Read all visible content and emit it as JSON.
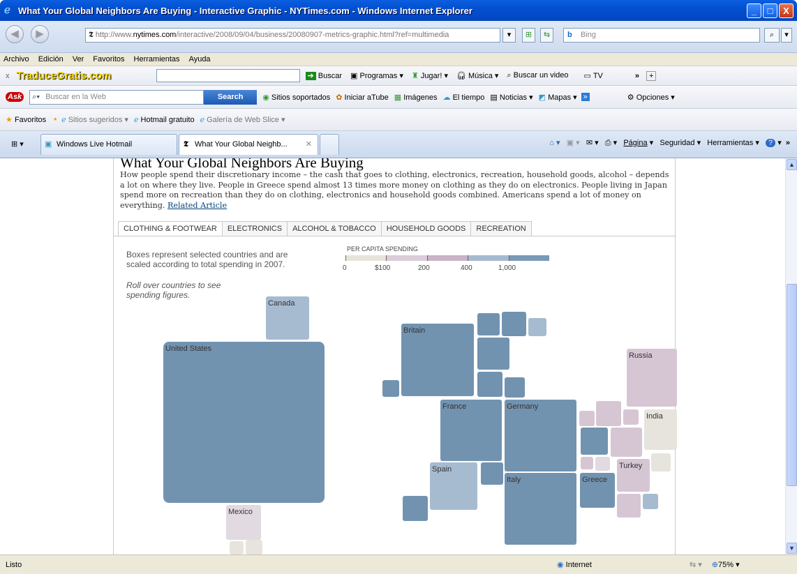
{
  "window": {
    "title": "What Your Global Neighbors Are Buying - Interactive Graphic - NYTimes.com - Windows Internet Explorer",
    "min": "_",
    "max": "□",
    "close": "X"
  },
  "address": {
    "prefix": "http://www.",
    "host": "nytimes.com",
    "path": "/interactive/2008/09/04/business/20080907-metrics-graphic.html?ref=multimedia",
    "search_placeholder": "Bing"
  },
  "menu": [
    "Archivo",
    "Edición",
    "Ver",
    "Favoritos",
    "Herramientas",
    "Ayuda"
  ],
  "toolbar1": {
    "close": "x",
    "brand": "TraduceGratis.com",
    "buscar": "Buscar",
    "programas": "Programas",
    "jugar": "Jugar!",
    "musica": "Música",
    "video": "Buscar un video",
    "tv": "TV",
    "more": "»",
    "plus": "+"
  },
  "toolbar2": {
    "placeholder": "Buscar en la Web",
    "search": "Search",
    "sitios": "Sitios soportados",
    "atube": "Iniciar aTube",
    "imagenes": "Imágenes",
    "tiempo": "El tiempo",
    "noticias": "Noticias",
    "mapas": "Mapas",
    "more": "»",
    "opciones": "Opciones"
  },
  "favbar": {
    "favoritos": "Favoritos",
    "sugeridos": "Sitios sugeridos",
    "hotmail": "Hotmail gratuito",
    "slice": "Galería de Web Slice"
  },
  "tabs": [
    "Windows Live Hotmail",
    "What Your Global Neighb..."
  ],
  "cmdbar": {
    "pagina": "Página",
    "seguridad": "Seguridad",
    "herramientas": "Herramientas",
    "more": "»"
  },
  "article": {
    "title": "What Your Global Neighbors Are Buying",
    "intro": "How people spend their discretionary income – the cash that goes to clothing, electronics, recreation, household goods, alcohol – depends a lot on where they live. People in Greece spend almost 13 times more money on clothing as they do on electronics. People living in Japan spend more on recreation than they do on clothing, electronics and household goods combined. Americans spend a lot of money on everything.",
    "link": "Related Article",
    "tabs": [
      "CLOTHING & FOOTWEAR",
      "ELECTRONICS",
      "ALCOHOL & TOBACCO",
      "HOUSEHOLD GOODS",
      "RECREATION"
    ],
    "note1": "Boxes represent selected countries and are",
    "note1b": "scaled according to total spending in 2007.",
    "note2": "Roll over countries to see",
    "note2b": "spending figures.",
    "legend_title": "PER CAPITA SPENDING",
    "legend_ticks": [
      "0",
      "$100",
      "200",
      "400",
      "1,000"
    ],
    "legend_colors": [
      "#e6e4dc",
      "#d9cdd8",
      "#c9b3c4",
      "#a6b9cf",
      "#7a9ab4"
    ]
  },
  "countries": {
    "canada": "Canada",
    "us": "United States",
    "mexico": "Mexico",
    "britain": "Britain",
    "russia": "Russia",
    "france": "France",
    "germany": "Germany",
    "india": "India",
    "spain": "Spain",
    "italy": "Italy",
    "greece": "Greece",
    "turkey": "Turkey"
  },
  "status": {
    "text": "Listo",
    "zone": "Internet",
    "zoom": "75%"
  }
}
